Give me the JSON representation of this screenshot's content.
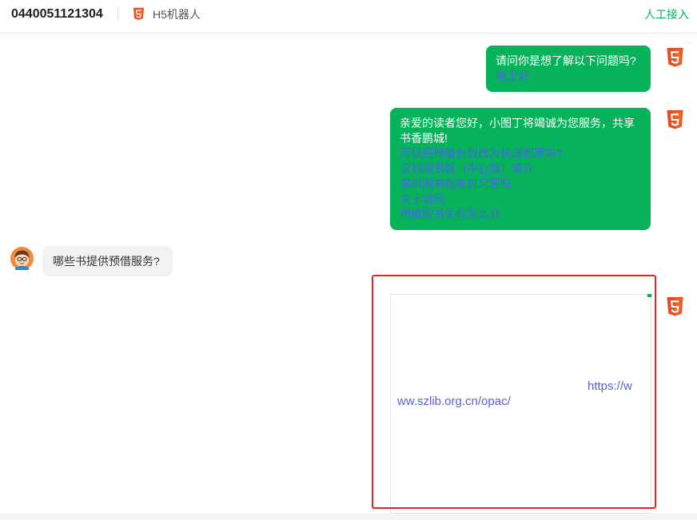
{
  "header": {
    "account_id": "0440051121304",
    "bot_icon": "html5-icon",
    "bot_name": "H5机器人",
    "transfer_label": "人工接入"
  },
  "chat": {
    "bot_avatar_icon": "html5-icon",
    "user_avatar_icon": "cartoon-user-avatar",
    "messages": [
      {
        "bot_text": "请问你是想了解以下问题吗?",
        "links": [
          "晚上好"
        ]
      },
      {
        "bot_text": "亲爱的读者您好，小图丁将竭诚为您服务，共享书香鹏城!",
        "links": [
          "可以把预借自取改为快递到家吗?",
          "深圳图书馆（中心馆）简介",
          "深圳图书馆有自习室吗",
          "关于调阅",
          "预借取书失败怎么办"
        ]
      },
      {
        "user_text": "哪些书提供预借服务?"
      },
      {
        "bot_link": "https://www.szlib.org.cn/opac/"
      }
    ]
  },
  "colors": {
    "accent_green": "#06b25a",
    "link_blue": "#4466e8",
    "url_link": "#5a5ed8",
    "highlight_red": "#e5281d",
    "html5_orange": "#e44d26",
    "user_bubble": "#f2f2f2"
  }
}
